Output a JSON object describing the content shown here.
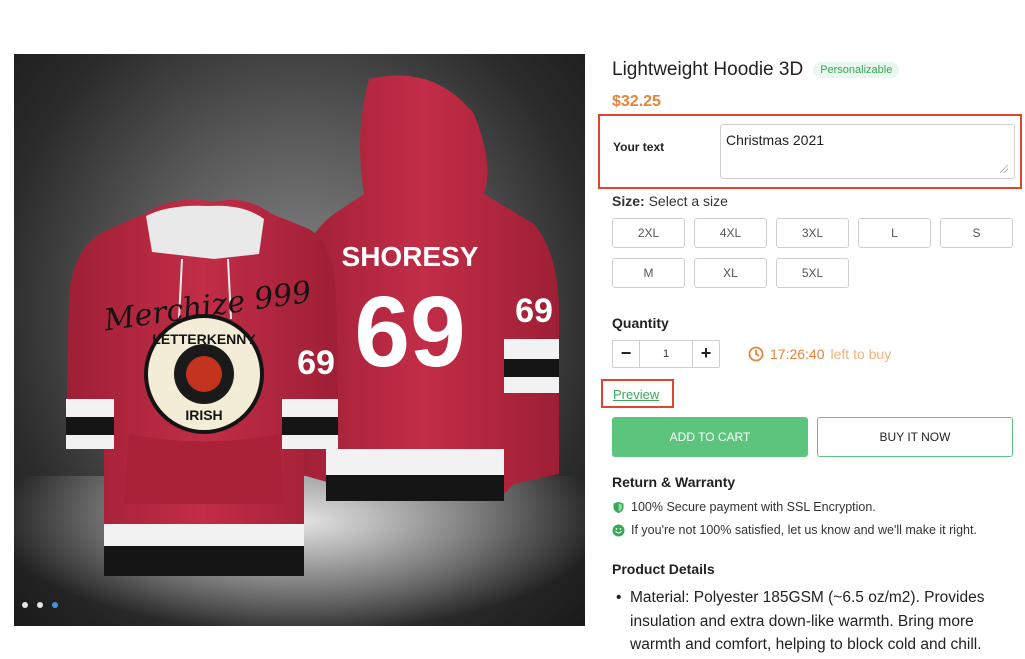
{
  "gallery": {
    "image_alt": "Hoodie front and back view",
    "front_print": {
      "script_text": "Merchize 999",
      "logo_top": "LETTERKENNY",
      "logo_bottom": "IRISH",
      "sleeve_number": "69"
    },
    "back_print": {
      "name": "SHORESY",
      "number": "69"
    },
    "dots": [
      {
        "active": false
      },
      {
        "active": false
      },
      {
        "active": true
      }
    ]
  },
  "product": {
    "title": "Lightweight Hoodie 3D",
    "badge": "Personalizable",
    "price": "$32.25"
  },
  "personalize": {
    "label": "Your text",
    "value": "Christmas 2021"
  },
  "size": {
    "label": "Size:",
    "hint": "Select a size",
    "options": [
      "2XL",
      "4XL",
      "3XL",
      "L",
      "S",
      "M",
      "XL",
      "5XL"
    ]
  },
  "quantity": {
    "label": "Quantity",
    "minus": "−",
    "value": "1",
    "plus": "+"
  },
  "timer": {
    "time": "17:26:40",
    "suffix": "left to buy"
  },
  "preview": {
    "label": "Preview"
  },
  "actions": {
    "add_to_cart": "ADD TO CART",
    "buy_now": "BUY IT NOW"
  },
  "return_warranty": {
    "title": "Return & Warranty",
    "items": [
      {
        "icon": "shield-icon",
        "text": "100% Secure payment with SSL Encryption."
      },
      {
        "icon": "smiley-icon",
        "text": "If you're not 100% satisfied, let us know and we'll make it right."
      }
    ]
  },
  "product_details": {
    "title": "Product Details",
    "bullets": [
      "Material: Polyester 185GSM (~6.5 oz/m2). Provides insulation and extra down-like warmth. Bring more warmth and comfort, helping to block cold and chill."
    ]
  },
  "colors": {
    "accent_green": "#5cc47c",
    "price_orange": "#e8833a",
    "highlight_red": "#e0442f",
    "hoodie_red": "#b8263f"
  }
}
